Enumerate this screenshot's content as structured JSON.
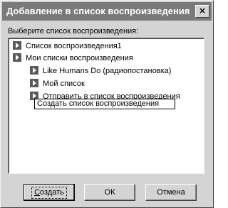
{
  "window": {
    "title": "Добавление в список воспроизведения",
    "close_label": "×"
  },
  "prompt": {
    "label": "Выберите список воспроизведения:"
  },
  "tree": {
    "items": [
      {
        "label": "Список воспроизведения1",
        "level": 0,
        "icon": "playlist-icon"
      },
      {
        "label": "Мои списки воспроизведения",
        "level": 0,
        "icon": "playlist-icon"
      },
      {
        "label": "Like Humans Do (радиопостановка)",
        "level": 1,
        "icon": "playlist-icon"
      },
      {
        "label": "Мой список",
        "level": 1,
        "icon": "playlist-icon"
      },
      {
        "label": "Отправить в список воспроизведения",
        "level": 1,
        "icon": "playlist-icon"
      }
    ],
    "new_item_edit_value": "Создать список воспроизведения"
  },
  "buttons": {
    "create_underline": "С",
    "create_rest": "оздать",
    "ok": "ОК",
    "cancel": "Отмена"
  }
}
